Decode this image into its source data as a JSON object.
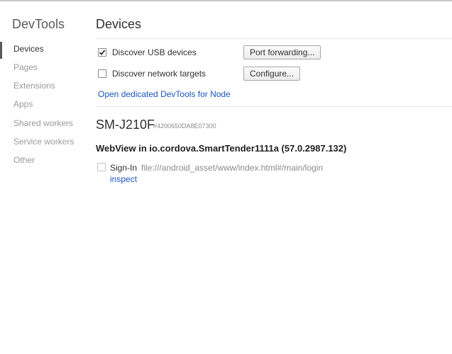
{
  "sidebar": {
    "title": "DevTools",
    "items": [
      {
        "label": "Devices",
        "active": true
      },
      {
        "label": "Pages"
      },
      {
        "label": "Extensions"
      },
      {
        "label": "Apps"
      },
      {
        "label": "Shared workers"
      },
      {
        "label": "Service workers"
      },
      {
        "label": "Other"
      }
    ]
  },
  "main": {
    "title": "Devices",
    "options": {
      "discover_usb": {
        "label": "Discover USB devices",
        "checked": true,
        "button": "Port forwarding..."
      },
      "discover_network": {
        "label": "Discover network targets",
        "checked": false,
        "button": "Configure..."
      }
    },
    "node_link": "Open dedicated DevTools for Node",
    "device": {
      "name": "SM-J210F",
      "serial": "#4200650DA8E07300",
      "webview": "WebView in io.cordova.SmartTender1111a (57.0.2987.132)",
      "target": {
        "name": "Sign-In",
        "url": "file:///android_asset/www/index.html#/main/login",
        "inspect": "inspect"
      }
    }
  },
  "icons": {
    "checkmark": "checkmark-icon"
  },
  "colors": {
    "link": "#1a55c0",
    "sidebar_active_indicator": "#5a5a5a"
  }
}
